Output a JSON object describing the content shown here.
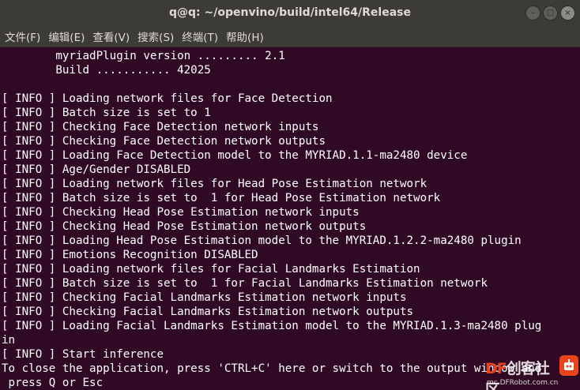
{
  "window": {
    "title": "q@q: ~/openvino/build/intel64/Release",
    "controls": {
      "minimize": "–",
      "maximize": "□",
      "close": "×"
    }
  },
  "menu": [
    "文件(F)",
    "编辑(E)",
    "查看(V)",
    "搜索(S)",
    "终端(T)",
    "帮助(H)"
  ],
  "terminal": {
    "lines": [
      "        myriadPlugin version ......... 2.1",
      "        Build ........... 42025",
      "",
      "[ INFO ] Loading network files for Face Detection",
      "[ INFO ] Batch size is set to 1",
      "[ INFO ] Checking Face Detection network inputs",
      "[ INFO ] Checking Face Detection network outputs",
      "[ INFO ] Loading Face Detection model to the MYRIAD.1.1-ma2480 device",
      "[ INFO ] Age/Gender DISABLED",
      "[ INFO ] Loading network files for Head Pose Estimation network",
      "[ INFO ] Batch size is set to  1 for Head Pose Estimation network",
      "[ INFO ] Checking Head Pose Estimation network inputs",
      "[ INFO ] Checking Head Pose Estimation network outputs",
      "[ INFO ] Loading Head Pose Estimation model to the MYRIAD.1.2.2-ma2480 plugin",
      "[ INFO ] Emotions Recognition DISABLED",
      "[ INFO ] Loading network files for Facial Landmarks Estimation",
      "[ INFO ] Batch size is set to  1 for Facial Landmarks Estimation network",
      "[ INFO ] Checking Facial Landmarks Estimation network inputs",
      "[ INFO ] Checking Facial Landmarks Estimation network outputs",
      "[ INFO ] Loading Facial Landmarks Estimation model to the MYRIAD.1.3-ma2480 plug",
      "in",
      "[ INFO ] Start inference",
      "To close the application, press 'CTRL+C' here or switch to the output window and",
      " press Q or Esc"
    ]
  },
  "watermark": {
    "logo_prefix": "DF",
    "logo_text": "创客社区",
    "url": "mc.DFRobot.com.cn"
  },
  "colors": {
    "terminal_bg": "#300a24",
    "titlebar_bg": "#3c3b37",
    "text": "#ffffff",
    "brand": "#e8431a"
  }
}
